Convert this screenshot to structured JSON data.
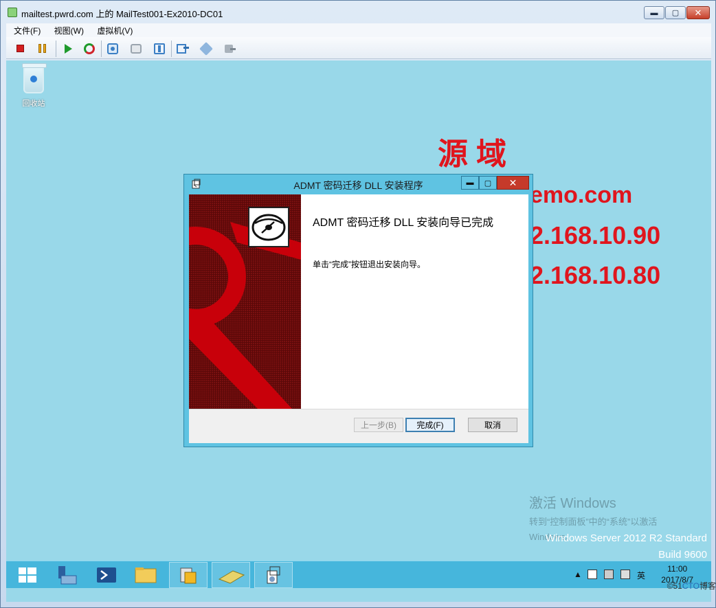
{
  "window": {
    "title": "mailtest.pwrd.com 上的 MailTest001-Ex2010-DC01",
    "min_glyph": "▬",
    "max_glyph": "▢",
    "close_glyph": "✕"
  },
  "menu": [
    "文件(F)",
    "视图(W)",
    "虚拟机(V)"
  ],
  "toolbar": {
    "icons": [
      "stop-icon",
      "pause-icon",
      "start-icon",
      "reset-icon",
      "snapshot-icon",
      "revert-icon",
      "settings-icon",
      "insert-disk-icon",
      "share-icon",
      "tools-icon"
    ]
  },
  "desktop": {
    "recycle_bin_label": "回收站",
    "overlay_title": "源域",
    "overlay_domain": "emo.com",
    "overlay_ip1": "2.168.10.90",
    "overlay_ip2": "2.168.10.80",
    "activate_line1": "激活 Windows",
    "activate_line2": "转到“控制面板”中的“系统”以激活",
    "activate_line3": "Windows。",
    "version_line1": "Windows Server 2012 R2 Standard",
    "version_line2": "Build 9600"
  },
  "dialog": {
    "title": "ADMT 密码迁移 DLL 安装程序",
    "heading": "ADMT 密码迁移 DLL 安装向导已完成",
    "message": "单击“完成”按钮退出安装向导。",
    "back_label": "上一步(B)",
    "finish_label": "完成(F)",
    "cancel_label": "取消"
  },
  "taskbar": {
    "tray_lang": "英",
    "time": "11:00",
    "date": "2017/8/7"
  },
  "watermark": {
    "prefix": "©51",
    "mid": "CTO",
    "suffix": "博客"
  }
}
